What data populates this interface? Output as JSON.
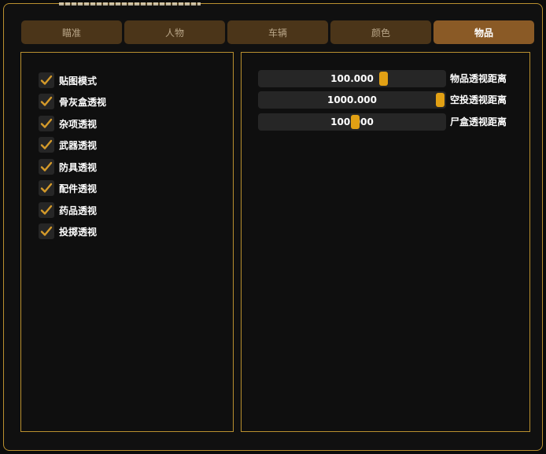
{
  "theme": {
    "accent": "#b9902f",
    "tab_active": "#8a5a26",
    "tab_inactive": "#4b3519",
    "thumb": "#e1a014",
    "check": "#d49a2a"
  },
  "tabs": [
    {
      "label": "瞄准"
    },
    {
      "label": "人物"
    },
    {
      "label": "车辆"
    },
    {
      "label": "颜色"
    },
    {
      "label": "物品",
      "active": true
    }
  ],
  "checkboxes": [
    {
      "label": "贴图模式",
      "checked": true
    },
    {
      "label": "骨灰盒透视",
      "checked": true
    },
    {
      "label": "杂项透视",
      "checked": true
    },
    {
      "label": "武器透视",
      "checked": true
    },
    {
      "label": "防具透视",
      "checked": true
    },
    {
      "label": "配件透视",
      "checked": true
    },
    {
      "label": "药品透视",
      "checked": true
    },
    {
      "label": "投掷透视",
      "checked": true
    }
  ],
  "sliders": [
    {
      "value": "100.000",
      "label": "物品透视距离",
      "fraction": 0.68
    },
    {
      "value": "1000.000",
      "label": "空投透视距离",
      "fraction": 1.0
    },
    {
      "value": "100.000",
      "label": "尸盒透视距离",
      "fraction": 0.52
    }
  ]
}
